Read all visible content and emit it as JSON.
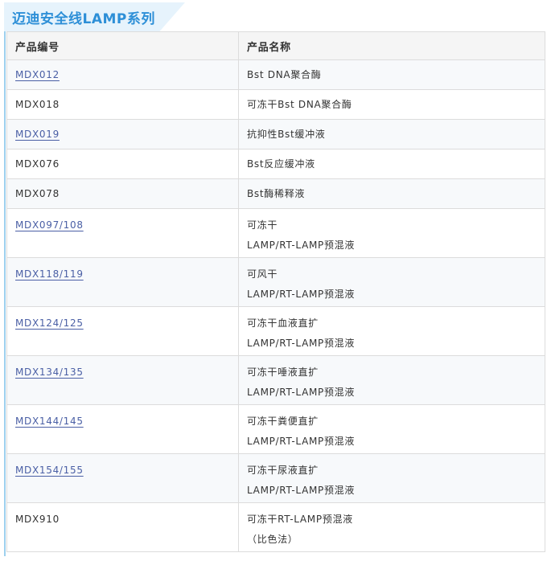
{
  "title": "迈迪安全线LAMP系列",
  "table": {
    "headers": [
      "产品编号",
      "产品名称"
    ],
    "rows": [
      {
        "code": "MDX012",
        "link": true,
        "name": [
          "Bst DNA聚合酶"
        ]
      },
      {
        "code": "MDX018",
        "link": false,
        "name": [
          "可冻干Bst DNA聚合酶"
        ]
      },
      {
        "code": "MDX019",
        "link": true,
        "name": [
          "抗抑性Bst缓冲液"
        ]
      },
      {
        "code": "MDX076",
        "link": false,
        "name": [
          "Bst反应缓冲液"
        ]
      },
      {
        "code": "MDX078",
        "link": false,
        "name": [
          "Bst酶稀释液"
        ]
      },
      {
        "code": "MDX097/108",
        "link": true,
        "name": [
          "可冻干",
          "LAMP/RT-LAMP预混液"
        ]
      },
      {
        "code": "MDX118/119",
        "link": true,
        "name": [
          "可风干",
          "LAMP/RT-LAMP预混液"
        ]
      },
      {
        "code": "MDX124/125",
        "link": true,
        "name": [
          "可冻干血液直扩",
          "LAMP/RT-LAMP预混液"
        ]
      },
      {
        "code": "MDX134/135",
        "link": true,
        "name": [
          "可冻干唾液直扩",
          "LAMP/RT-LAMP预混液"
        ]
      },
      {
        "code": "MDX144/145",
        "link": true,
        "name": [
          "可冻干粪便直扩",
          "LAMP/RT-LAMP预混液"
        ]
      },
      {
        "code": "MDX154/155",
        "link": true,
        "name": [
          "可冻干尿液直扩",
          "LAMP/RT-LAMP预混液"
        ]
      },
      {
        "code": "MDX910",
        "link": false,
        "name": [
          "可冻干RT-LAMP预混液",
          "（比色法）"
        ]
      }
    ]
  },
  "colors": {
    "title": "#2d8fd7",
    "title_bg": "#e6f3fc",
    "link": "#4a5fa5",
    "border": "#dcdcdc"
  }
}
